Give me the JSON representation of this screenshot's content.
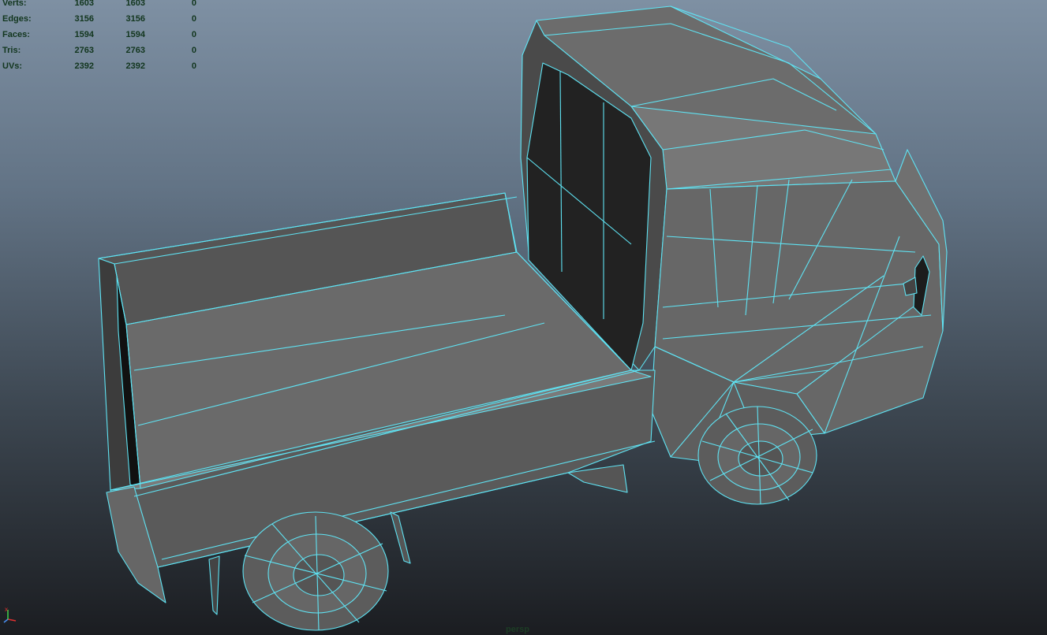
{
  "viewport": {
    "camera_label": "persp",
    "background_top": "#7e90a3",
    "background_bottom": "#1b1d21",
    "wire_color": "#5fe3f3",
    "mesh_color": "#6e6e6e"
  },
  "hud": {
    "rows": [
      {
        "label": "Verts:",
        "v1": "1603",
        "v2": "1603",
        "v3": "0"
      },
      {
        "label": "Edges:",
        "v1": "3156",
        "v2": "3156",
        "v3": "0"
      },
      {
        "label": "Faces:",
        "v1": "1594",
        "v2": "1594",
        "v3": "0"
      },
      {
        "label": "Tris:",
        "v1": "2763",
        "v2": "2763",
        "v3": "0"
      },
      {
        "label": "UVs:",
        "v1": "2392",
        "v2": "2392",
        "v3": "0"
      }
    ]
  },
  "axis_gizmo": {
    "x_label": "x",
    "icon": "axis-gizmo-icon",
    "x_color": "#e23030",
    "y_color": "#3fd34a",
    "z_color": "#4a8ff0"
  }
}
